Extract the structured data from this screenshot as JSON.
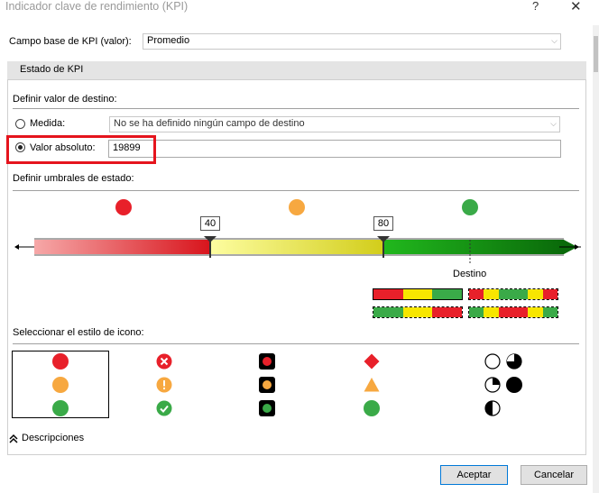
{
  "window": {
    "title": "Indicador clave de rendimiento (KPI)",
    "help_glyph": "?",
    "close_glyph": "✕"
  },
  "kpi_base": {
    "label": "Campo base de KPI (valor):",
    "value": "Promedio"
  },
  "status_section": {
    "header": "Estado de KPI"
  },
  "target": {
    "heading": "Definir valor de destino:",
    "measure_label": "Medida:",
    "measure_value": "No se ha definido ningún campo de destino",
    "measure_selected": false,
    "absolute_label": "Valor absoluto:",
    "absolute_value": "19899",
    "absolute_selected": true
  },
  "thresholds": {
    "heading": "Definir umbrales de estado:",
    "low": "40",
    "high": "80",
    "target_label": "Destino",
    "status_colors": {
      "red": "#e8202a",
      "yellow": "#f7a840",
      "green": "#3aaa48"
    }
  },
  "icon_style": {
    "heading": "Seleccionar el estilo de icono:",
    "selected_index": 0
  },
  "descriptions": {
    "label": "Descripciones",
    "icon": "chevron-up-double-icon"
  },
  "buttons": {
    "ok": "Aceptar",
    "cancel": "Cancelar"
  },
  "colors": {
    "accent": "#0078d7",
    "highlight": "#e5141d"
  }
}
